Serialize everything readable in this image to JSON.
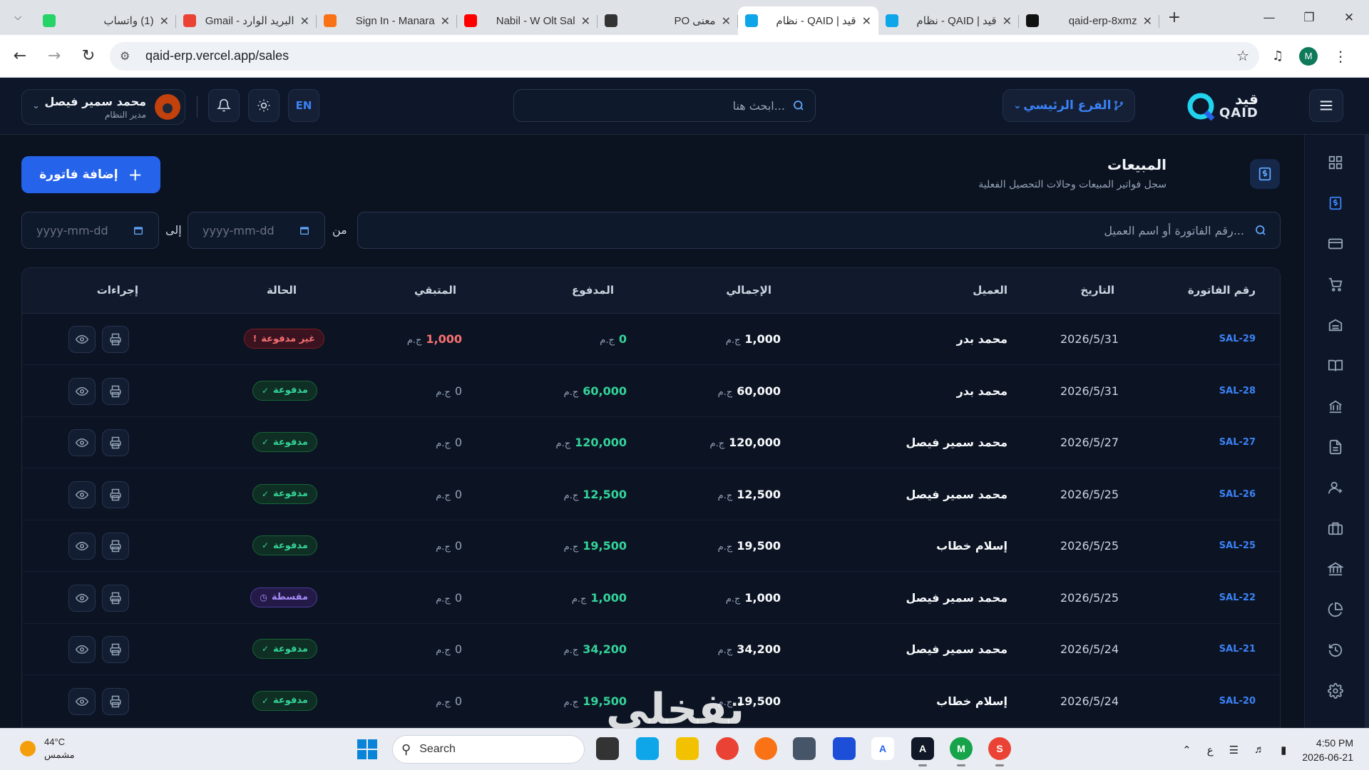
{
  "browser": {
    "tabs": [
      {
        "title": "(1) واتساب",
        "icon": "whatsapp-icon",
        "color": "#25d366"
      },
      {
        "title": "البريد الوارد - Gmail",
        "icon": "gmail-icon",
        "color": "#ea4335"
      },
      {
        "title": "Sign In - Manara",
        "icon": "manara-icon",
        "color": "#f97316"
      },
      {
        "title": "Nabil - W Olt Sal",
        "icon": "youtube-icon",
        "color": "#ff0000"
      },
      {
        "title": "معنى PO",
        "icon": "chatgpt-icon",
        "color": "#333333"
      },
      {
        "title": "قيد | QAID - نظام",
        "icon": "qaid-icon",
        "color": "#0ea5e9"
      },
      {
        "title": "قيد | QAID - نظام",
        "icon": "qaid-icon",
        "color": "#0ea5e9"
      },
      {
        "title": "qaid-erp-8xmz",
        "icon": "vercel-icon",
        "color": "#111111"
      }
    ],
    "active_tab": 5,
    "url": "qaid-erp.vercel.app/sales",
    "profile_initial": "M"
  },
  "header": {
    "user_name": "محمد سمير فيصل",
    "user_role": "مدير النظام",
    "lang": "EN",
    "search_placeholder": "ابحث هنا...",
    "branch": "الفرع الرئيسي",
    "logo_ar": "قيد",
    "logo_en": "QAID"
  },
  "page": {
    "title": "المبيعات",
    "subtitle": "سجل فواتير المبيعات وحالات التحصيل الفعلية",
    "add_button": "إضافة فاتورة"
  },
  "filters": {
    "search_placeholder": "رقم الفاتورة أو اسم العميل...",
    "from_label": "من",
    "to_label": "إلى",
    "date_placeholder": "yyyy-mm-dd"
  },
  "table": {
    "columns": {
      "invoice": "رقم الفاتورة",
      "date": "التاريخ",
      "client": "العميل",
      "total": "الإجمالي",
      "paid": "المدفوع",
      "remaining": "المتبقي",
      "status": "الحالة",
      "actions": "إجراءات"
    },
    "currency": "ج.م",
    "rows": [
      {
        "invoice": "SAL-29",
        "date": "2026/5/31",
        "client": "محمد بدر",
        "total": "1,000",
        "paid": "0",
        "remaining": "1,000",
        "status": "غير مدفوعة",
        "status_type": "unpaid"
      },
      {
        "invoice": "SAL-28",
        "date": "2026/5/31",
        "client": "محمد بدر",
        "total": "60,000",
        "paid": "60,000",
        "remaining": "0",
        "status": "مدفوعة",
        "status_type": "paid"
      },
      {
        "invoice": "SAL-27",
        "date": "2026/5/27",
        "client": "محمد سمير فيصل",
        "total": "120,000",
        "paid": "120,000",
        "remaining": "0",
        "status": "مدفوعة",
        "status_type": "paid"
      },
      {
        "invoice": "SAL-26",
        "date": "2026/5/25",
        "client": "محمد سمير فيصل",
        "total": "12,500",
        "paid": "12,500",
        "remaining": "0",
        "status": "مدفوعة",
        "status_type": "paid"
      },
      {
        "invoice": "SAL-25",
        "date": "2026/5/25",
        "client": "إسلام خطاب",
        "total": "19,500",
        "paid": "19,500",
        "remaining": "0",
        "status": "مدفوعة",
        "status_type": "paid"
      },
      {
        "invoice": "SAL-22",
        "date": "2026/5/25",
        "client": "محمد سمير فيصل",
        "total": "1,000",
        "paid": "1,000",
        "remaining": "0",
        "status": "مقسطة",
        "status_type": "installment"
      },
      {
        "invoice": "SAL-21",
        "date": "2026/5/24",
        "client": "محمد سمير فيصل",
        "total": "34,200",
        "paid": "34,200",
        "remaining": "0",
        "status": "مدفوعة",
        "status_type": "paid"
      },
      {
        "invoice": "SAL-20",
        "date": "2026/5/24",
        "client": "إسلام خطاب",
        "total": "19,500",
        "paid": "19,500",
        "remaining": "0",
        "status": "مدفوعة",
        "status_type": "paid"
      }
    ]
  },
  "sidebar_icons": [
    "dashboard-icon",
    "sales-icon",
    "card-icon",
    "cart-icon",
    "inventory-icon",
    "journal-icon",
    "bank-icon",
    "document-icon",
    "users-icon",
    "briefcase-icon",
    "institution-icon",
    "pie-chart-icon",
    "history-icon",
    "settings-icon"
  ],
  "colors": {
    "accent": "#2563eb",
    "paid": "#34d399",
    "unpaid": "#f87171",
    "installment": "#a78bfa",
    "background": "#0b1220"
  },
  "watermark": "تفخلي",
  "taskbar": {
    "temperature": "44°C",
    "weather": "مشمس",
    "search": "Search",
    "time": "4:50 PM",
    "date": "2026-06-21",
    "lang": "ع"
  }
}
